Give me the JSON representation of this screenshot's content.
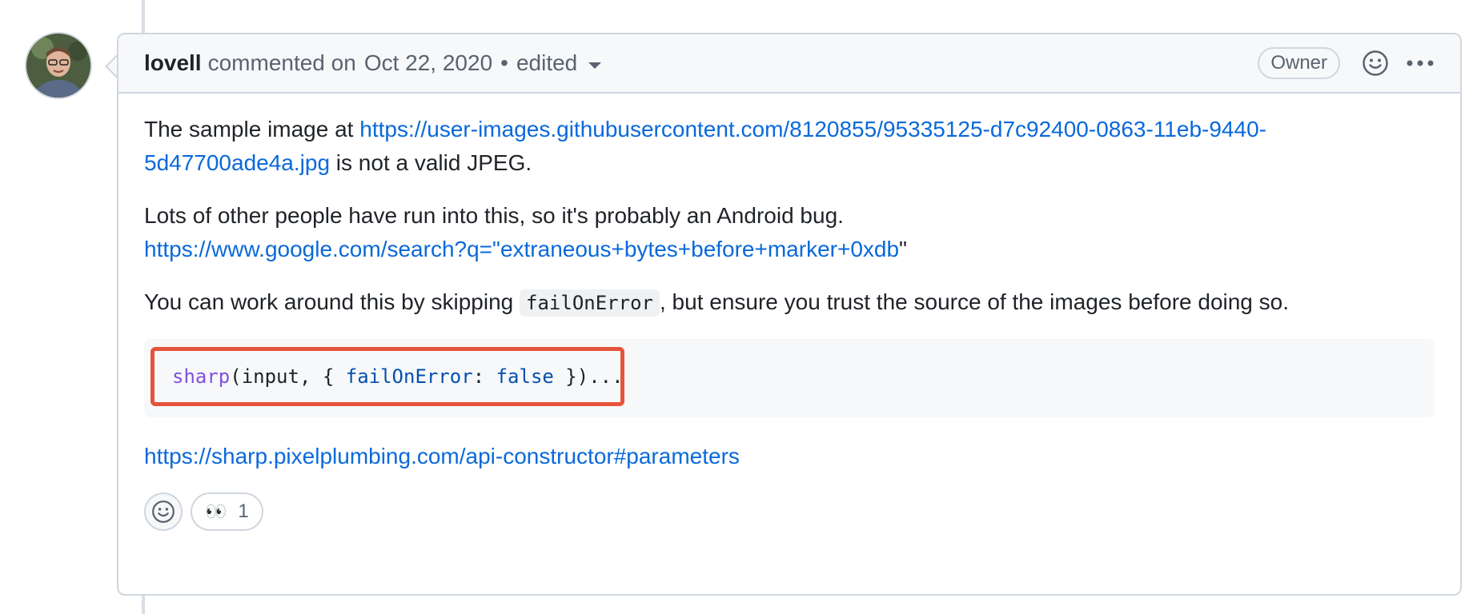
{
  "comment": {
    "author": "lovell",
    "action_text": "commented on",
    "date": "Oct 22, 2020",
    "separator": "•",
    "edited_label": "edited",
    "role_badge": "Owner",
    "icons": {
      "avatar": "user-avatar",
      "reaction": "smiley-icon",
      "more": "kebab-horizontal-icon"
    }
  },
  "body": {
    "p1_prefix": "The sample image at ",
    "p1_link": "https://user-images.githubusercontent.com/8120855/95335125-d7c92400-0863-11eb-9440-5d47700ade4a.jpg",
    "p1_suffix": " is not a valid JPEG.",
    "p2_text": "Lots of other people have run into this, so it's probably an Android bug.",
    "p2_link": "https://www.google.com/search?q=\"extraneous+bytes+before+marker+0xdb",
    "p2_trailing": "\"",
    "p3_prefix": "You can work around this by skipping ",
    "p3_code": "failOnError",
    "p3_suffix": ", but ensure you trust the source of the images before doing so.",
    "code": {
      "fn": "sharp",
      "part1": "(input, { ",
      "prop": "failOnError",
      "part2": ": ",
      "kw": "false",
      "part3": " })..."
    },
    "docs_link": "https://sharp.pixelplumbing.com/api-constructor#parameters"
  },
  "reactions": {
    "add_icon": "smiley-icon",
    "items": [
      {
        "emoji": "👀",
        "count": "1"
      }
    ]
  },
  "colors": {
    "link": "#0969da",
    "highlight_border": "#e5543a",
    "border": "#d0d7de"
  }
}
